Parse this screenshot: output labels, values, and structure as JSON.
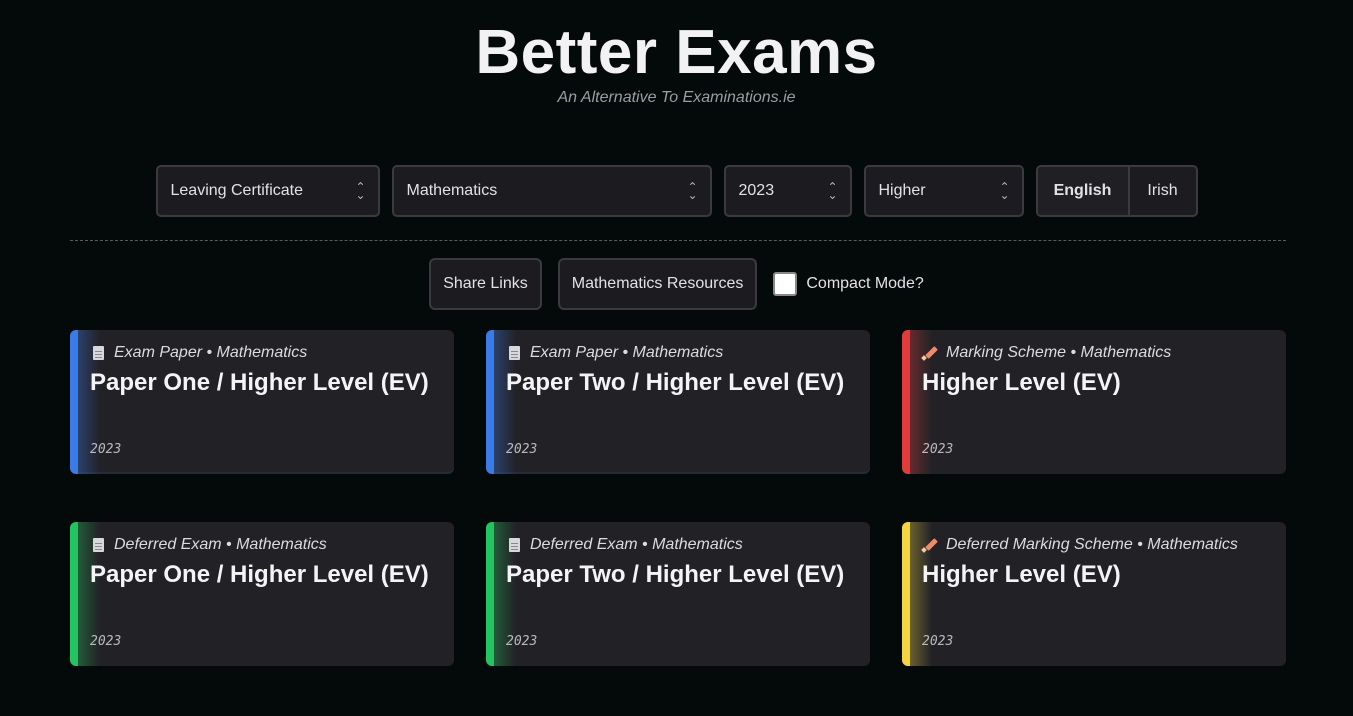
{
  "header": {
    "title": "Better Exams",
    "subtitle": "An Alternative To Examinations.ie"
  },
  "filters": {
    "certificate": "Leaving Certificate",
    "subject": "Mathematics",
    "year": "2023",
    "level": "Higher",
    "languages": [
      "English",
      "Irish"
    ],
    "active_language": "English"
  },
  "actions": {
    "share_label": "Share Links",
    "resources_label": "Mathematics Resources",
    "compact_label": "Compact Mode?",
    "compact_checked": false
  },
  "cards": [
    {
      "type": "Exam Paper • Mathematics",
      "title": "Paper One / Higher Level (EV)",
      "year": "2023",
      "icon": "document-icon",
      "accent": "#3b7be8"
    },
    {
      "type": "Exam Paper • Mathematics",
      "title": "Paper Two / Higher Level (EV)",
      "year": "2023",
      "icon": "document-icon",
      "accent": "#3b7be8"
    },
    {
      "type": "Marking Scheme • Mathematics",
      "title": "Higher Level (EV)",
      "year": "2023",
      "icon": "pencil-icon",
      "accent": "#e23b3b"
    },
    {
      "type": "Deferred Exam • Mathematics",
      "title": "Paper One / Higher Level (EV)",
      "year": "2023",
      "icon": "document-icon",
      "accent": "#22c55e"
    },
    {
      "type": "Deferred Exam • Mathematics",
      "title": "Paper Two / Higher Level (EV)",
      "year": "2023",
      "icon": "document-icon",
      "accent": "#22c55e"
    },
    {
      "type": "Deferred Marking Scheme • Mathematics",
      "title": "Higher Level (EV)",
      "year": "2023",
      "icon": "pencil-icon",
      "accent": "#f5d442"
    }
  ]
}
